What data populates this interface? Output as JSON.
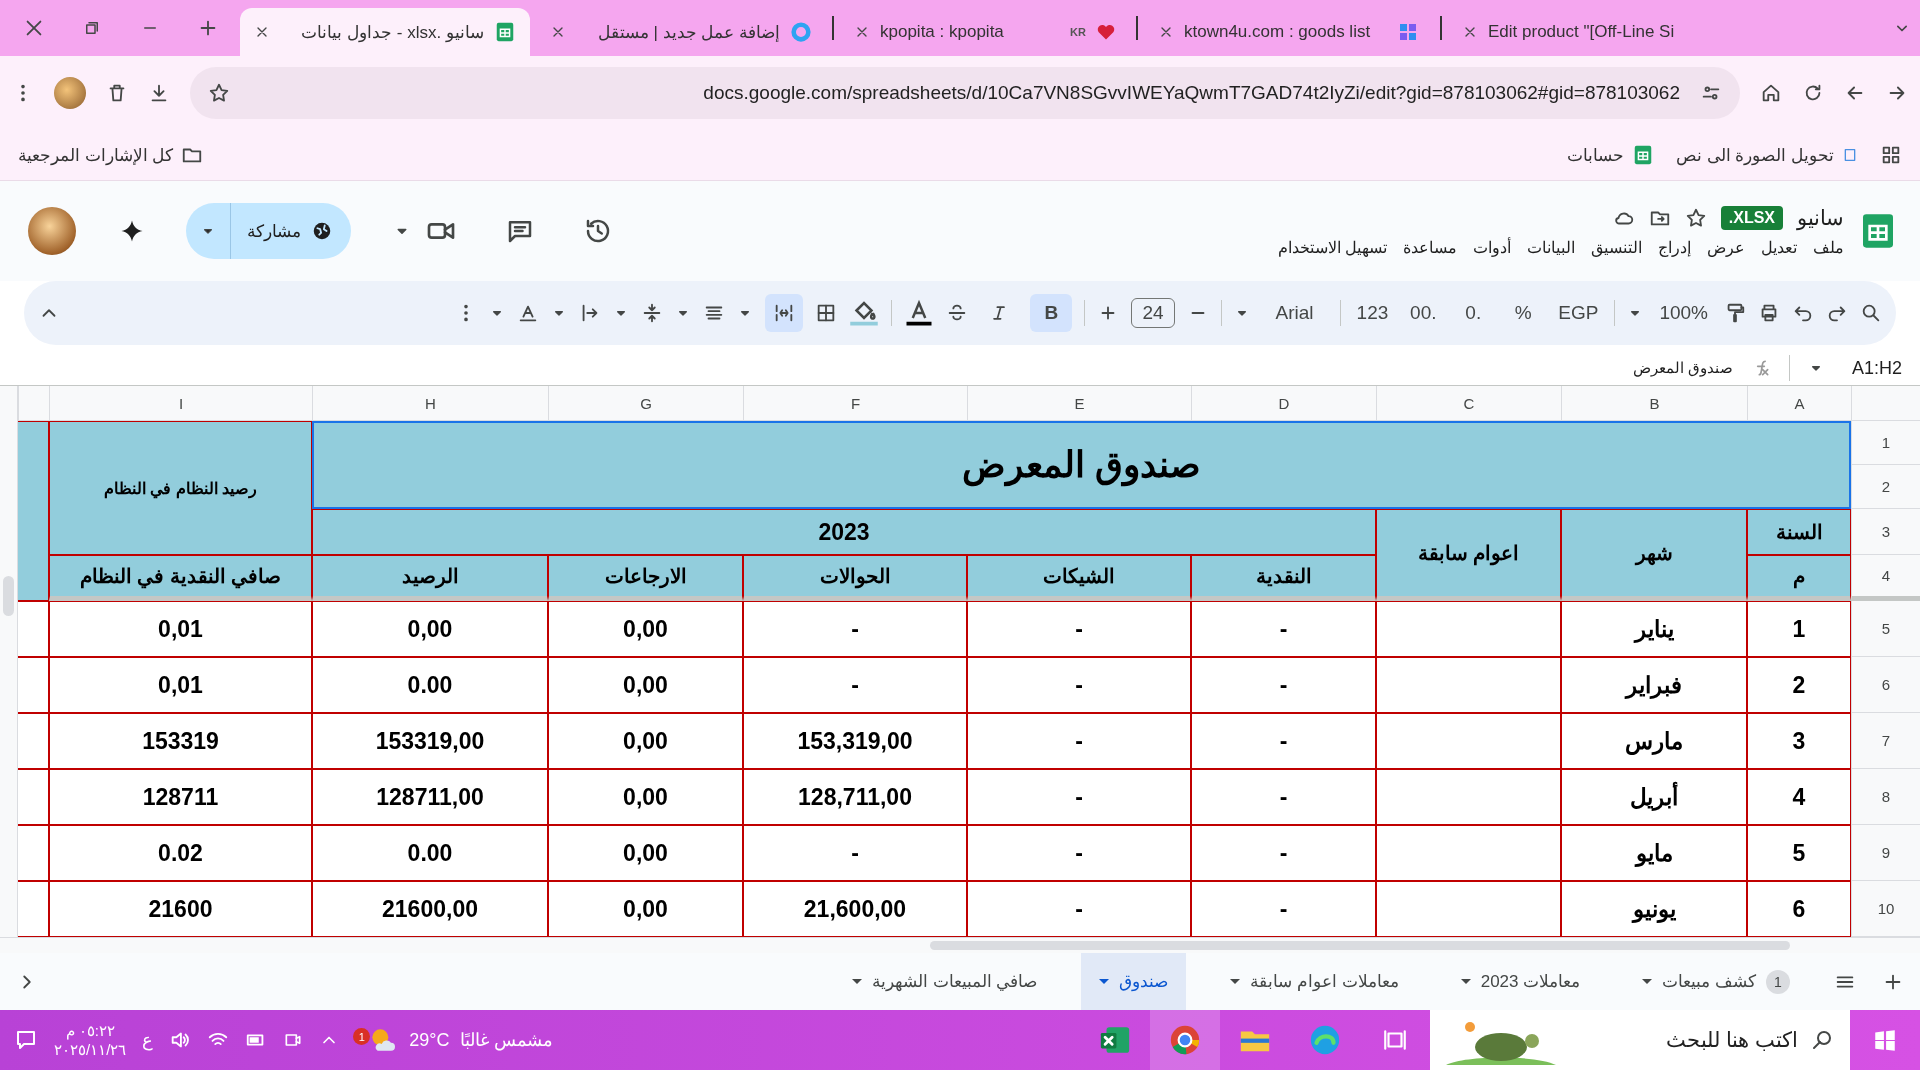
{
  "browser": {
    "tabs": [
      {
        "title": "Edit product \"[Off-Line Si",
        "selected": false,
        "kind": "none"
      },
      {
        "title": "ktown4u.com : goods list",
        "selected": false,
        "kind": "puzzle"
      },
      {
        "title": "kpopita : kpopita",
        "selected": false,
        "kind": "heart",
        "tag": "KR"
      },
      {
        "title": "إضافة عمل جديد | مستقل",
        "selected": false,
        "kind": "ring"
      },
      {
        "title": "سانيو .xlsx - جداول بيانات",
        "selected": true,
        "kind": "sheets"
      }
    ],
    "url": "docs.google.com/spreadsheets/d/10Ca7VN8SGvvIWEYaQwmT7GAD74t2IyZi/edit?gid=878103062#gid=878103062",
    "bookmarks": [
      {
        "label": "تحويل الصورة الى نص",
        "kind": "page"
      },
      {
        "label": "حسابات",
        "kind": "sheets"
      }
    ],
    "all_bookmarks": "كل الإشارات المرجعية"
  },
  "app": {
    "title": "سانيو",
    "badge": "XLSX.",
    "menu": [
      "ملف",
      "تعديل",
      "عرض",
      "إدراج",
      "التنسيق",
      "البيانات",
      "أدوات",
      "مساعدة",
      "تسهيل الاستخدام"
    ],
    "share": "مشاركة"
  },
  "toolbar": {
    "zoom": "100%",
    "currency": "EGP",
    "percent": "%",
    "dec_less": ".0",
    "dec_more": ".00",
    "format": "123",
    "font": "Arial",
    "font_size": "24",
    "bold_label": "B",
    "bold": true,
    "italic": false,
    "wrap": true
  },
  "formula_bar": {
    "name_box": "A1:H2",
    "formula": "صندوق المعرض"
  },
  "sheet": {
    "columns": [
      "A",
      "B",
      "C",
      "D",
      "E",
      "F",
      "G",
      "H",
      "I"
    ],
    "row_numbers": [
      "1",
      "2",
      "3",
      "4",
      "5",
      "6",
      "7",
      "8",
      "9",
      "10"
    ],
    "title": "صندوق المعرض",
    "year_label": "السنة",
    "index_label": "م",
    "month_label": "شهر",
    "prior_label": "اعوام سابقة",
    "year": "2023",
    "side_label": "رصيد النظام في النظام",
    "headers": [
      "النقدية",
      "الشيكات",
      "الحوالات",
      "الارجاعات",
      "الرصيد",
      "صافي النقدية في النظام"
    ],
    "rows": [
      {
        "num": "1",
        "month": "يناير",
        "values": [
          "-",
          "-",
          "-",
          "0,00",
          "0,00",
          "0,01"
        ]
      },
      {
        "num": "2",
        "month": "فبراير",
        "values": [
          "-",
          "-",
          "-",
          "0,00",
          "0.00",
          "0,01"
        ]
      },
      {
        "num": "3",
        "month": "مارس",
        "values": [
          "-",
          "-",
          "153,319,00",
          "0,00",
          "153319,00",
          "153319"
        ]
      },
      {
        "num": "4",
        "month": "أبريل",
        "values": [
          "-",
          "-",
          "128,711,00",
          "0,00",
          "128711,00",
          "128711"
        ]
      },
      {
        "num": "5",
        "month": "مايو",
        "values": [
          "-",
          "-",
          "-",
          "0,00",
          "0.00",
          "0.02"
        ]
      },
      {
        "num": "6",
        "month": "يونيو",
        "values": [
          "-",
          "-",
          "21,600,00",
          "0,00",
          "21600,00",
          "21600"
        ]
      }
    ]
  },
  "sheet_tabs": [
    {
      "label": "كشف مبيعات",
      "selected": false,
      "count": "1"
    },
    {
      "label": "معاملات 2023",
      "selected": false
    },
    {
      "label": "معاملات اعوام سابقة",
      "selected": false
    },
    {
      "label": "صندوق",
      "selected": true
    },
    {
      "label": "صافي المبيعات الشهرية",
      "selected": false
    }
  ],
  "taskbar": {
    "search": "اكتب هنا للبحث",
    "weather": "مشمس غالبًا",
    "temperature": "29°C",
    "weather_badge": "1",
    "language": "ع",
    "time": "٠٥:٢٢ م",
    "date": "٢٠٢٥/١١/٢٦"
  }
}
